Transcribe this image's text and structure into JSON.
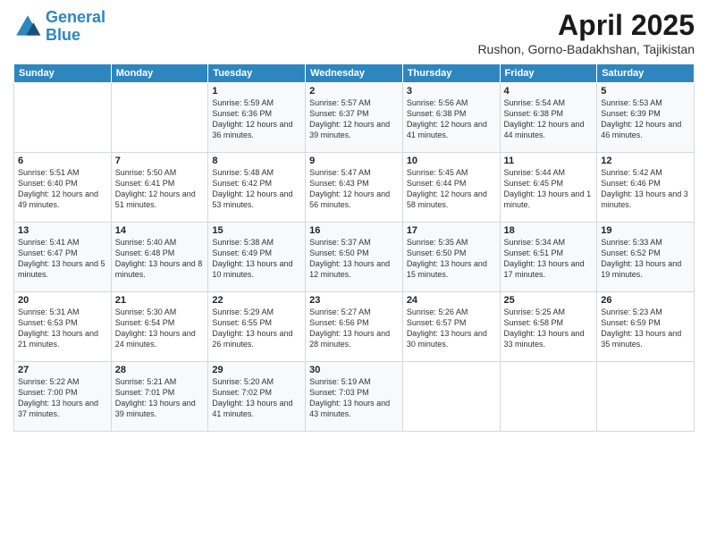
{
  "header": {
    "logo_line1": "General",
    "logo_line2": "Blue",
    "title": "April 2025",
    "location": "Rushon, Gorno-Badakhshan, Tajikistan"
  },
  "weekdays": [
    "Sunday",
    "Monday",
    "Tuesday",
    "Wednesday",
    "Thursday",
    "Friday",
    "Saturday"
  ],
  "weeks": [
    [
      {
        "day": "",
        "detail": ""
      },
      {
        "day": "",
        "detail": ""
      },
      {
        "day": "1",
        "detail": "Sunrise: 5:59 AM\nSunset: 6:36 PM\nDaylight: 12 hours\nand 36 minutes."
      },
      {
        "day": "2",
        "detail": "Sunrise: 5:57 AM\nSunset: 6:37 PM\nDaylight: 12 hours\nand 39 minutes."
      },
      {
        "day": "3",
        "detail": "Sunrise: 5:56 AM\nSunset: 6:38 PM\nDaylight: 12 hours\nand 41 minutes."
      },
      {
        "day": "4",
        "detail": "Sunrise: 5:54 AM\nSunset: 6:38 PM\nDaylight: 12 hours\nand 44 minutes."
      },
      {
        "day": "5",
        "detail": "Sunrise: 5:53 AM\nSunset: 6:39 PM\nDaylight: 12 hours\nand 46 minutes."
      }
    ],
    [
      {
        "day": "6",
        "detail": "Sunrise: 5:51 AM\nSunset: 6:40 PM\nDaylight: 12 hours\nand 49 minutes."
      },
      {
        "day": "7",
        "detail": "Sunrise: 5:50 AM\nSunset: 6:41 PM\nDaylight: 12 hours\nand 51 minutes."
      },
      {
        "day": "8",
        "detail": "Sunrise: 5:48 AM\nSunset: 6:42 PM\nDaylight: 12 hours\nand 53 minutes."
      },
      {
        "day": "9",
        "detail": "Sunrise: 5:47 AM\nSunset: 6:43 PM\nDaylight: 12 hours\nand 56 minutes."
      },
      {
        "day": "10",
        "detail": "Sunrise: 5:45 AM\nSunset: 6:44 PM\nDaylight: 12 hours\nand 58 minutes."
      },
      {
        "day": "11",
        "detail": "Sunrise: 5:44 AM\nSunset: 6:45 PM\nDaylight: 13 hours\nand 1 minute."
      },
      {
        "day": "12",
        "detail": "Sunrise: 5:42 AM\nSunset: 6:46 PM\nDaylight: 13 hours\nand 3 minutes."
      }
    ],
    [
      {
        "day": "13",
        "detail": "Sunrise: 5:41 AM\nSunset: 6:47 PM\nDaylight: 13 hours\nand 5 minutes."
      },
      {
        "day": "14",
        "detail": "Sunrise: 5:40 AM\nSunset: 6:48 PM\nDaylight: 13 hours\nand 8 minutes."
      },
      {
        "day": "15",
        "detail": "Sunrise: 5:38 AM\nSunset: 6:49 PM\nDaylight: 13 hours\nand 10 minutes."
      },
      {
        "day": "16",
        "detail": "Sunrise: 5:37 AM\nSunset: 6:50 PM\nDaylight: 13 hours\nand 12 minutes."
      },
      {
        "day": "17",
        "detail": "Sunrise: 5:35 AM\nSunset: 6:50 PM\nDaylight: 13 hours\nand 15 minutes."
      },
      {
        "day": "18",
        "detail": "Sunrise: 5:34 AM\nSunset: 6:51 PM\nDaylight: 13 hours\nand 17 minutes."
      },
      {
        "day": "19",
        "detail": "Sunrise: 5:33 AM\nSunset: 6:52 PM\nDaylight: 13 hours\nand 19 minutes."
      }
    ],
    [
      {
        "day": "20",
        "detail": "Sunrise: 5:31 AM\nSunset: 6:53 PM\nDaylight: 13 hours\nand 21 minutes."
      },
      {
        "day": "21",
        "detail": "Sunrise: 5:30 AM\nSunset: 6:54 PM\nDaylight: 13 hours\nand 24 minutes."
      },
      {
        "day": "22",
        "detail": "Sunrise: 5:29 AM\nSunset: 6:55 PM\nDaylight: 13 hours\nand 26 minutes."
      },
      {
        "day": "23",
        "detail": "Sunrise: 5:27 AM\nSunset: 6:56 PM\nDaylight: 13 hours\nand 28 minutes."
      },
      {
        "day": "24",
        "detail": "Sunrise: 5:26 AM\nSunset: 6:57 PM\nDaylight: 13 hours\nand 30 minutes."
      },
      {
        "day": "25",
        "detail": "Sunrise: 5:25 AM\nSunset: 6:58 PM\nDaylight: 13 hours\nand 33 minutes."
      },
      {
        "day": "26",
        "detail": "Sunrise: 5:23 AM\nSunset: 6:59 PM\nDaylight: 13 hours\nand 35 minutes."
      }
    ],
    [
      {
        "day": "27",
        "detail": "Sunrise: 5:22 AM\nSunset: 7:00 PM\nDaylight: 13 hours\nand 37 minutes."
      },
      {
        "day": "28",
        "detail": "Sunrise: 5:21 AM\nSunset: 7:01 PM\nDaylight: 13 hours\nand 39 minutes."
      },
      {
        "day": "29",
        "detail": "Sunrise: 5:20 AM\nSunset: 7:02 PM\nDaylight: 13 hours\nand 41 minutes."
      },
      {
        "day": "30",
        "detail": "Sunrise: 5:19 AM\nSunset: 7:03 PM\nDaylight: 13 hours\nand 43 minutes."
      },
      {
        "day": "",
        "detail": ""
      },
      {
        "day": "",
        "detail": ""
      },
      {
        "day": "",
        "detail": ""
      }
    ]
  ]
}
